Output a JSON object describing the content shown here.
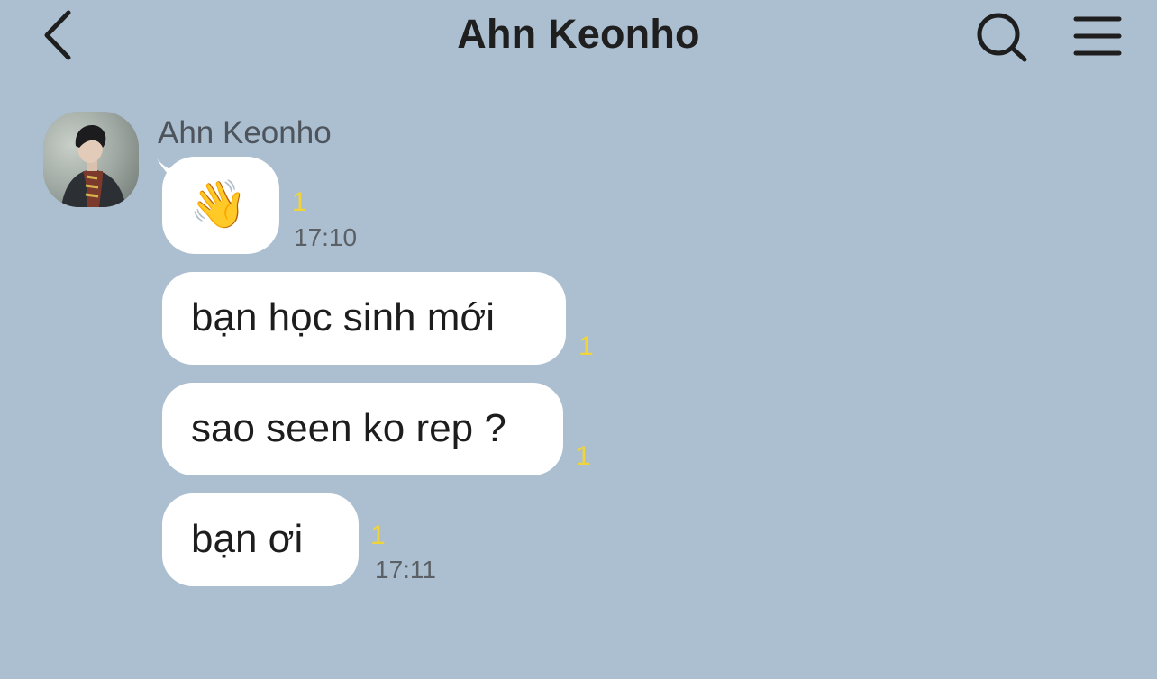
{
  "header": {
    "title": "Ahn Keonho",
    "back_icon": "chevron-left-icon",
    "search_icon": "search-icon",
    "menu_icon": "menu-icon"
  },
  "chat": {
    "sender_name": "Ahn Keonho",
    "messages": [
      {
        "text": "👋",
        "unread": "1",
        "time": "17:10"
      },
      {
        "text": "bạn học sinh mới",
        "unread": "1",
        "time": ""
      },
      {
        "text": "sao seen ko rep ?",
        "unread": "1",
        "time": ""
      },
      {
        "text": "bạn ơi",
        "unread": "1",
        "time": "17:11"
      }
    ]
  },
  "colors": {
    "background": "#acbfd0",
    "bubble": "#ffffff",
    "unread": "#f0d43a"
  }
}
